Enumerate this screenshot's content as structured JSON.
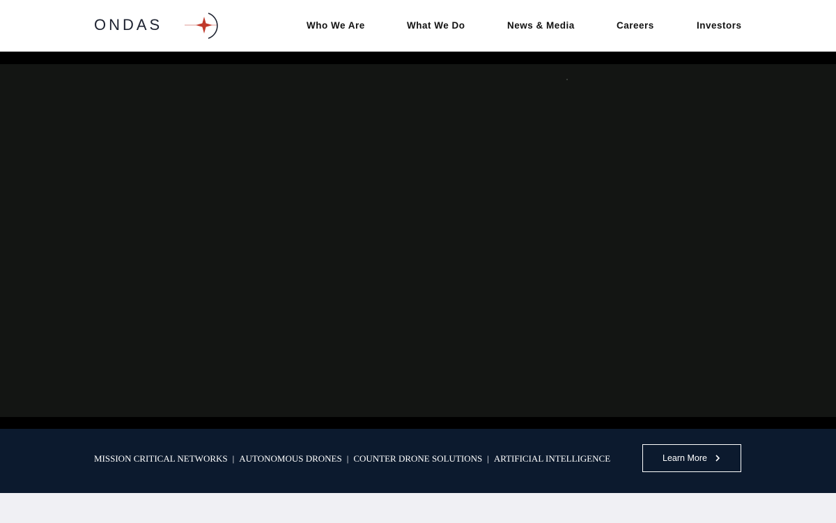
{
  "header": {
    "logo_text": "ONDAS",
    "nav": [
      {
        "label": "Who We Are"
      },
      {
        "label": "What We Do"
      },
      {
        "label": "News & Media"
      },
      {
        "label": "Careers"
      },
      {
        "label": "Investors"
      }
    ]
  },
  "banner": {
    "tags": [
      "MISSION CRITICAL NETWORKS",
      "AUTONOMOUS DRONES",
      "COUNTER DRONE SOLUTIONS",
      "ARTIFICIAL INTELLIGENCE"
    ],
    "separator": "|",
    "cta_label": "Learn More"
  },
  "colors": {
    "header_bg": "#ffffff",
    "hero_bg": "#131513",
    "banner_bg": "#0c1a2e",
    "logo_accent": "#c0392b",
    "footer_strip": "#f0f0f4"
  },
  "icons": {
    "logo_mark": "star-orbit-icon",
    "cta_arrow": "chevron-right-icon"
  }
}
